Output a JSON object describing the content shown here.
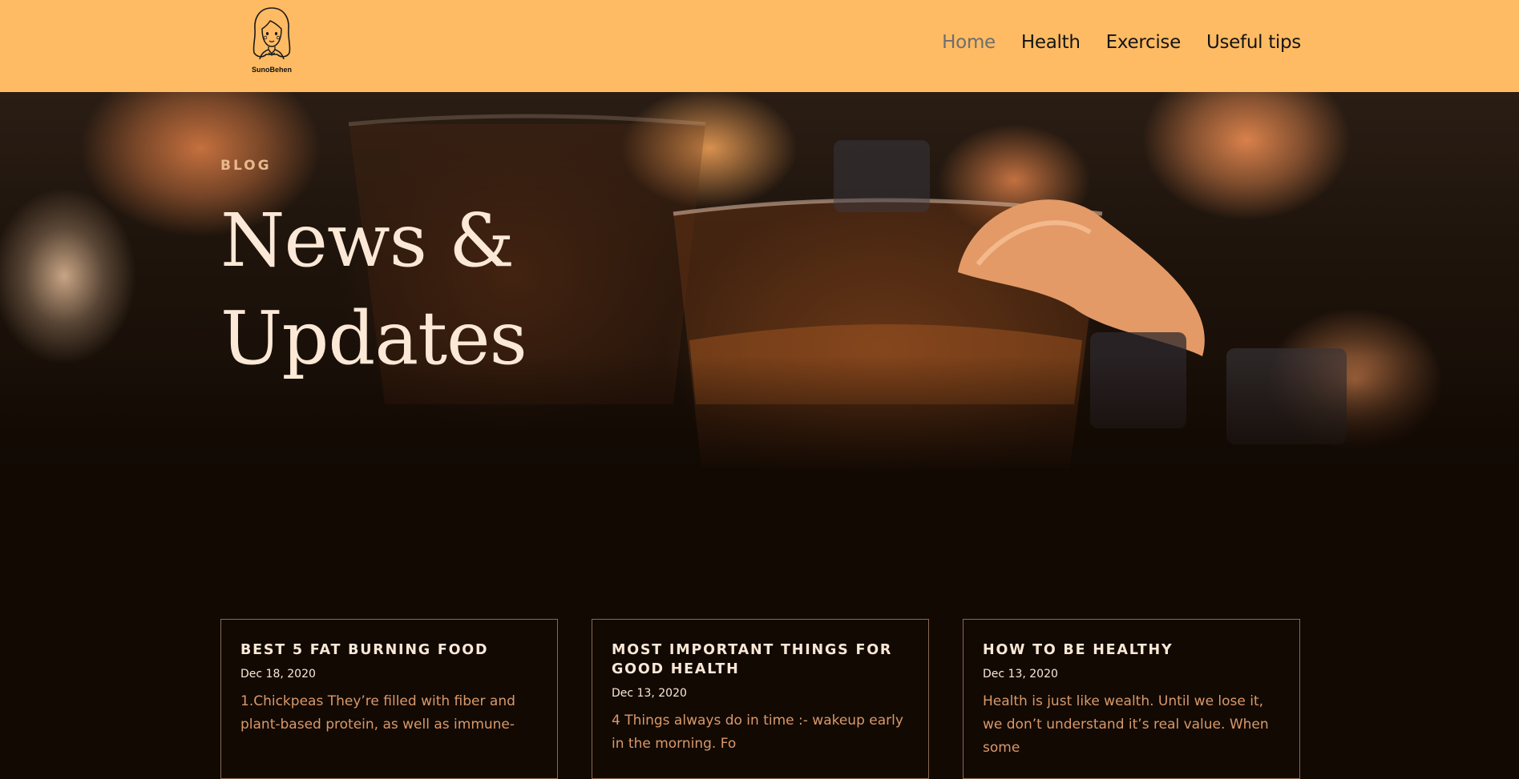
{
  "header": {
    "logo_text": "SunoBehen",
    "nav": [
      {
        "label": "Home",
        "active": true
      },
      {
        "label": "Health",
        "active": false
      },
      {
        "label": "Exercise",
        "active": false
      },
      {
        "label": "Useful tips",
        "active": false
      }
    ]
  },
  "hero": {
    "eyebrow": "BLOG",
    "title": "News & Updates"
  },
  "posts": [
    {
      "title": "BEST 5 FAT BURNING FOOD",
      "date": "Dec 18, 2020",
      "excerpt": "1.Chickpeas They’re filled with fiber and plant-based protein, as well as immune-"
    },
    {
      "title": "MOST IMPORTANT THINGS FOR GOOD HEALTH",
      "date": "Dec 13, 2020",
      "excerpt": "4 Things always do in time :- wakeup early in the morning. Fo"
    },
    {
      "title": "HOW TO BE HEALTHY",
      "date": "Dec 13, 2020",
      "excerpt": "Health is just like wealth. Until we lose it, we don’t understand it’s real value. When some"
    }
  ],
  "colors": {
    "header_bg": "#ffbb63",
    "page_bg": "#120903",
    "accent_text": "#d9996a",
    "title_text": "#fbe8d6"
  }
}
